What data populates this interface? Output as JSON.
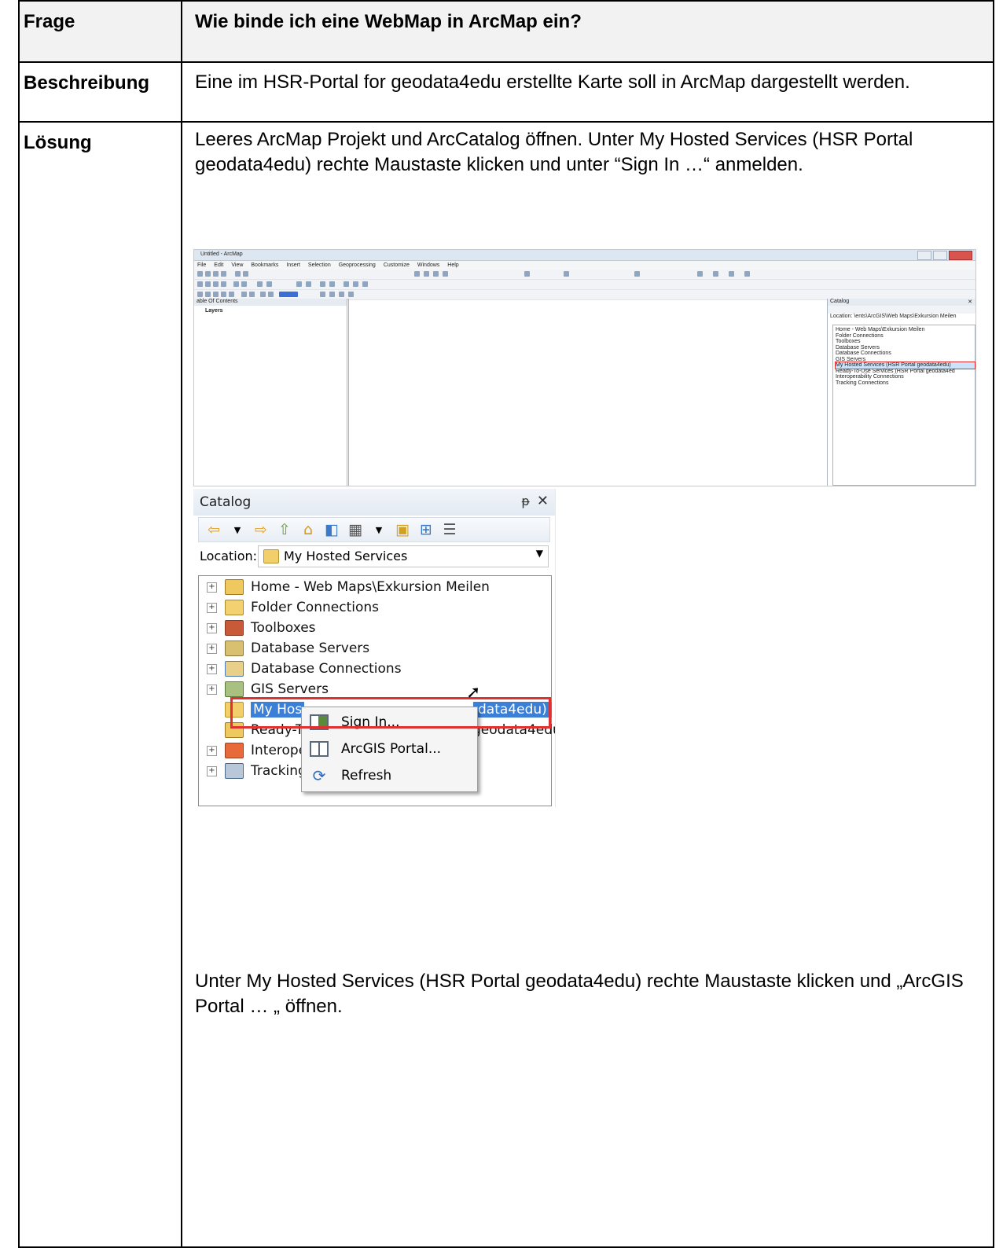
{
  "table": {
    "rows": [
      {
        "label": "Frage",
        "text": "Wie binde ich eine WebMap in ArcMap ein?"
      },
      {
        "label": "Beschreibung",
        "text": "Eine im HSR-Portal for geodata4edu erstellte Karte soll in ArcMap dargestellt werden."
      },
      {
        "label": "Lösung",
        "intro": "Leeres ArcMap Projekt und ArcCatalog öffnen. Unter My Hosted Services (HSR Portal geodata4edu) rechte Maustaste klicken und unter “Sign In …“ anmelden.",
        "outro": "Unter My Hosted Services (HSR Portal geodata4edu) rechte Maustaste klicken und „ArcGIS Portal … „ öffnen."
      }
    ]
  },
  "arcmap": {
    "title": "Untitled - ArcMap",
    "menu": [
      "File",
      "Edit",
      "View",
      "Bookmarks",
      "Insert",
      "Selection",
      "Geoprocessing",
      "Customize",
      "Windows",
      "Help"
    ],
    "toc_title": "able Of Contents",
    "layers": "Layers",
    "catalog_title": "Catalog",
    "location": "Location:  \\ents\\ArcGIS\\Web Maps\\Exkursion Meilen",
    "tree": [
      "Home - Web Maps\\Exkursion Meilen",
      "Folder Connections",
      "Toolboxes",
      "Database Servers",
      "Database Connections",
      "GIS Servers",
      "My Hosted Services (HSR Portal geodata4edu)",
      "Ready-To-Use Services (HSR Portal geodata4ed",
      "Interoperability Connections",
      "Tracking Connections"
    ]
  },
  "catalog": {
    "title": "Catalog",
    "pin": "ᵽ",
    "close": "✕",
    "location_label": "Location:",
    "location_value": "My Hosted Services",
    "nodes": [
      "Home - Web Maps\\Exkursion Meilen",
      "Folder Connections",
      "Toolboxes",
      "Database Servers",
      "Database Connections",
      "GIS Servers",
      "My Hos",
      "Ready-T",
      "Interope",
      "Tracking"
    ],
    "node_tails": {
      "myhosted": "data4edu)",
      "ready": "geodata4edu"
    },
    "context_menu": [
      "Sign In...",
      "ArcGIS Portal...",
      "Refresh"
    ]
  }
}
